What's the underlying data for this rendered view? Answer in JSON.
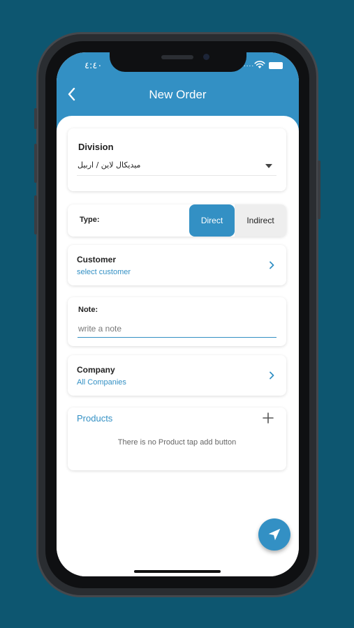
{
  "status_bar": {
    "time": "٤:٤٠",
    "signal_dots": "...."
  },
  "header": {
    "title": "New Order",
    "back_icon": "chevron-left-icon"
  },
  "division": {
    "label": "Division",
    "value": "ميديكال لاين / اربيل"
  },
  "type": {
    "label": "Type:",
    "options": [
      "Direct",
      "Indirect"
    ],
    "selected": "Direct"
  },
  "customer": {
    "label": "Customer",
    "placeholder": "select customer"
  },
  "note": {
    "label": "Note:",
    "placeholder": "write a note"
  },
  "company": {
    "label": "Company",
    "value": "All Companies"
  },
  "products": {
    "label": "Products",
    "empty_text": "There is no Product tap add button"
  },
  "fab": {
    "icon": "navigation-arrow-icon"
  },
  "colors": {
    "primary": "#3390c4",
    "background": "#0d5670"
  }
}
